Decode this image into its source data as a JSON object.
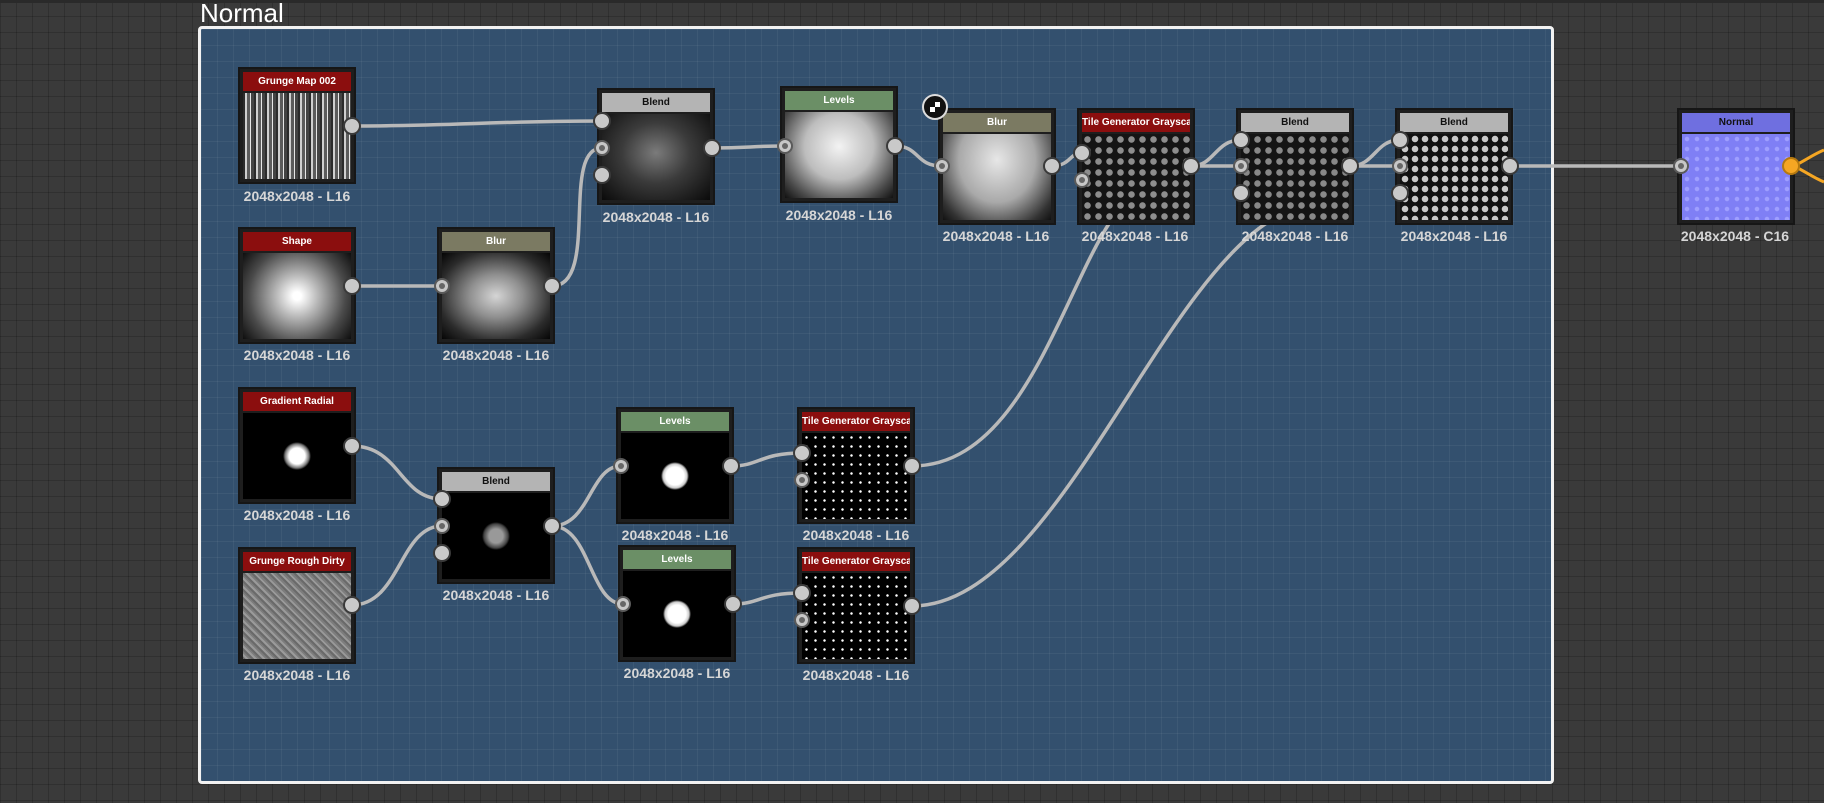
{
  "frame": {
    "title": "Normal"
  },
  "nodes": {
    "grunge_map": {
      "title": "Grunge Map 002",
      "caption": "2048x2048 - L16",
      "header_color": "#8b0e0e"
    },
    "shape": {
      "title": "Shape",
      "caption": "2048x2048 - L16",
      "header_color": "#8b0e0e"
    },
    "blur_1": {
      "title": "Blur",
      "caption": "2048x2048 - L16",
      "header_color": "#7b7a62"
    },
    "blend_1": {
      "title": "Blend",
      "caption": "2048x2048 - L16",
      "header_color": "#b4b4b4"
    },
    "levels_1": {
      "title": "Levels",
      "caption": "2048x2048 - L16",
      "header_color": "#6b8f66"
    },
    "blur_2": {
      "title": "Blur",
      "caption": "2048x2048 - L16",
      "header_color": "#7b7a62"
    },
    "tile_gen_1": {
      "title": "Tile Generator Grayscale",
      "caption": "2048x2048 - L16",
      "header_color": "#8b0e0e"
    },
    "blend_3": {
      "title": "Blend",
      "caption": "2048x2048 - L16",
      "header_color": "#b4b4b4"
    },
    "blend_4": {
      "title": "Blend",
      "caption": "2048x2048 - L16",
      "header_color": "#b4b4b4"
    },
    "normal": {
      "title": "Normal",
      "caption": "2048x2048 - C16",
      "header_color": "#6f6fe0"
    },
    "gradient_radial": {
      "title": "Gradient Radial",
      "caption": "2048x2048 - L16",
      "header_color": "#8b0e0e"
    },
    "grunge_rough": {
      "title": "Grunge Rough Dirty",
      "caption": "2048x2048 - L16",
      "header_color": "#8b0e0e"
    },
    "blend_2": {
      "title": "Blend",
      "caption": "2048x2048 - L16",
      "header_color": "#b4b4b4"
    },
    "levels_2": {
      "title": "Levels",
      "caption": "2048x2048 - L16",
      "header_color": "#6b8f66"
    },
    "levels_3": {
      "title": "Levels",
      "caption": "2048x2048 - L16",
      "header_color": "#6b8f66"
    },
    "tile_gen_2": {
      "title": "Tile Generator Grayscale",
      "caption": "2048x2048 - L16",
      "header_color": "#8b0e0e"
    },
    "tile_gen_3": {
      "title": "Tile Generator Grayscale",
      "caption": "2048x2048 - L16",
      "header_color": "#8b0e0e"
    }
  }
}
